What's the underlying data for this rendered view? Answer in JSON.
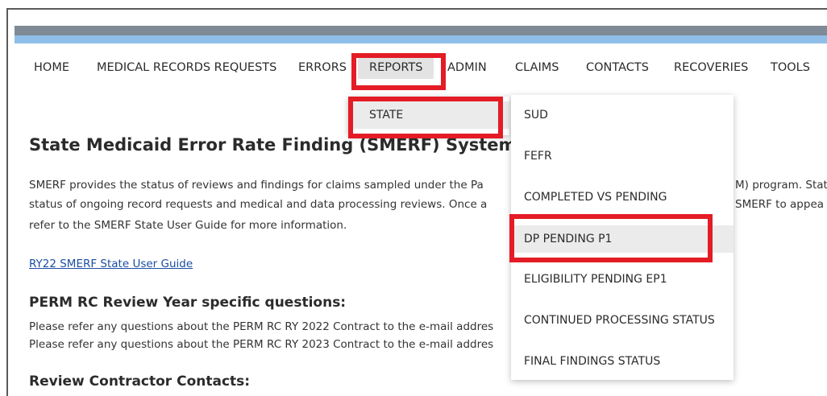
{
  "nav": {
    "items": [
      {
        "label": "HOME"
      },
      {
        "label": "MEDICAL RECORDS REQUESTS"
      },
      {
        "label": "ERRORS"
      },
      {
        "label": "REPORTS"
      },
      {
        "label": "ADMIN"
      },
      {
        "label": "CLAIMS"
      },
      {
        "label": "CONTACTS"
      },
      {
        "label": "RECOVERIES"
      },
      {
        "label": "TOOLS"
      }
    ]
  },
  "reports_menu": {
    "items": [
      {
        "label": "STATE"
      }
    ]
  },
  "state_submenu": {
    "items": [
      {
        "label": "SUD"
      },
      {
        "label": "FEFR"
      },
      {
        "label": "COMPLETED VS PENDING"
      },
      {
        "label": "DP PENDING P1"
      },
      {
        "label": "ELIGIBILITY PENDING EP1"
      },
      {
        "label": "CONTINUED PROCESSING STATUS"
      },
      {
        "label": "FINAL FINDINGS STATUS"
      }
    ]
  },
  "main": {
    "title": "State Medicaid Error Rate Finding (SMERF) System",
    "intro_line1_left": "SMERF provides the status of reviews and findings for claims sampled under the Pa",
    "intro_line1_right": "M) program. State",
    "intro_line2_left": "status of ongoing record requests and medical and data processing reviews. Once a",
    "intro_line2_right": "SMERF to appea",
    "intro_line3": "refer to the SMERF State User Guide for more information.",
    "guide_link": "RY22 SMERF State User Guide",
    "questions_heading": "PERM RC Review Year specific questions:",
    "questions_line1": "Please refer any questions about the PERM RC RY 2022 Contract to the e-mail addres",
    "questions_line2": "Please refer any questions about the PERM RC RY 2023 Contract to the e-mail addres",
    "contacts_heading": "Review Contractor Contacts:"
  },
  "colors": {
    "highlight": "#e31c25",
    "bar_dark": "#7e8a96",
    "bar_light": "#8fbfe8",
    "link": "#1a4fa3"
  }
}
